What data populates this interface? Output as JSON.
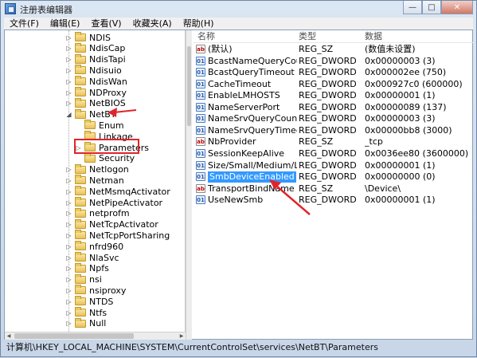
{
  "window": {
    "title": "注册表编辑器",
    "controls": [
      "—",
      "□",
      "✕"
    ]
  },
  "menu": [
    "文件(F)",
    "编辑(E)",
    "查看(V)",
    "收藏夹(A)",
    "帮助(H)"
  ],
  "tree": {
    "items": [
      {
        "label": "NDIS",
        "expander": "▷",
        "level": 0
      },
      {
        "label": "NdisCap",
        "expander": "▷",
        "level": 0
      },
      {
        "label": "NdisTapi",
        "expander": "▷",
        "level": 0
      },
      {
        "label": "Ndisuio",
        "expander": "▷",
        "level": 0
      },
      {
        "label": "NdisWan",
        "expander": "▷",
        "level": 0
      },
      {
        "label": "NDProxy",
        "expander": "▷",
        "level": 0
      },
      {
        "label": "NetBIOS",
        "expander": "▷",
        "level": 0
      },
      {
        "label": "NetBT",
        "expander": "◢",
        "level": 0
      },
      {
        "label": "Enum",
        "expander": "",
        "level": 1
      },
      {
        "label": "Linkage",
        "expander": "",
        "level": 1
      },
      {
        "label": "Parameters",
        "expander": "▷",
        "level": 1
      },
      {
        "label": "Security",
        "expander": "",
        "level": 1
      },
      {
        "label": "Netlogon",
        "expander": "▷",
        "level": 0
      },
      {
        "label": "Netman",
        "expander": "▷",
        "level": 0
      },
      {
        "label": "NetMsmqActivator",
        "expander": "▷",
        "level": 0
      },
      {
        "label": "NetPipeActivator",
        "expander": "▷",
        "level": 0
      },
      {
        "label": "netprofm",
        "expander": "▷",
        "level": 0
      },
      {
        "label": "NetTcpActivator",
        "expander": "▷",
        "level": 0
      },
      {
        "label": "NetTcpPortSharing",
        "expander": "▷",
        "level": 0
      },
      {
        "label": "nfrd960",
        "expander": "▷",
        "level": 0
      },
      {
        "label": "NlaSvc",
        "expander": "▷",
        "level": 0
      },
      {
        "label": "Npfs",
        "expander": "▷",
        "level": 0
      },
      {
        "label": "nsi",
        "expander": "▷",
        "level": 0
      },
      {
        "label": "nsiproxy",
        "expander": "▷",
        "level": 0
      },
      {
        "label": "NTDS",
        "expander": "▷",
        "level": 0
      },
      {
        "label": "Ntfs",
        "expander": "▷",
        "level": 0
      },
      {
        "label": "Null",
        "expander": "▷",
        "level": 0
      }
    ]
  },
  "columns": {
    "name": "名称",
    "type": "类型",
    "data": "数据"
  },
  "values": [
    {
      "name": "(默认)",
      "type": "REG_SZ",
      "data": "(数值未设置)",
      "icon": "string-value-icon"
    },
    {
      "name": "BcastNameQueryCount",
      "type": "REG_DWORD",
      "data": "0x00000003 (3)",
      "icon": "dword-value-icon"
    },
    {
      "name": "BcastQueryTimeout",
      "type": "REG_DWORD",
      "data": "0x000002ee (750)",
      "icon": "dword-value-icon"
    },
    {
      "name": "CacheTimeout",
      "type": "REG_DWORD",
      "data": "0x000927c0 (600000)",
      "icon": "dword-value-icon"
    },
    {
      "name": "EnableLMHOSTS",
      "type": "REG_DWORD",
      "data": "0x00000001 (1)",
      "icon": "dword-value-icon"
    },
    {
      "name": "NameServerPort",
      "type": "REG_DWORD",
      "data": "0x00000089 (137)",
      "icon": "dword-value-icon"
    },
    {
      "name": "NameSrvQueryCount",
      "type": "REG_DWORD",
      "data": "0x00000003 (3)",
      "icon": "dword-value-icon"
    },
    {
      "name": "NameSrvQueryTimeout",
      "type": "REG_DWORD",
      "data": "0x00000bb8 (3000)",
      "icon": "dword-value-icon"
    },
    {
      "name": "NbProvider",
      "type": "REG_SZ",
      "data": "_tcp",
      "icon": "string-value-icon"
    },
    {
      "name": "SessionKeepAlive",
      "type": "REG_DWORD",
      "data": "0x0036ee80 (3600000)",
      "icon": "dword-value-icon"
    },
    {
      "name": "Size/Small/Medium/Large",
      "type": "REG_DWORD",
      "data": "0x00000001 (1)",
      "icon": "dword-value-icon"
    },
    {
      "name": "SmbDeviceEnabled",
      "type": "REG_DWORD",
      "data": "0x00000000 (0)",
      "icon": "dword-value-icon",
      "selected": true
    },
    {
      "name": "TransportBindName",
      "type": "REG_SZ",
      "data": "\\Device\\",
      "icon": "string-value-icon"
    },
    {
      "name": "UseNewSmb",
      "type": "REG_DWORD",
      "data": "0x00000001 (1)",
      "icon": "dword-value-icon"
    }
  ],
  "status": "计算机\\HKEY_LOCAL_MACHINE\\SYSTEM\\CurrentControlSet\\services\\NetBT\\Parameters",
  "colors": {
    "annotation": "#e0242b",
    "selection": "#3399ff"
  }
}
